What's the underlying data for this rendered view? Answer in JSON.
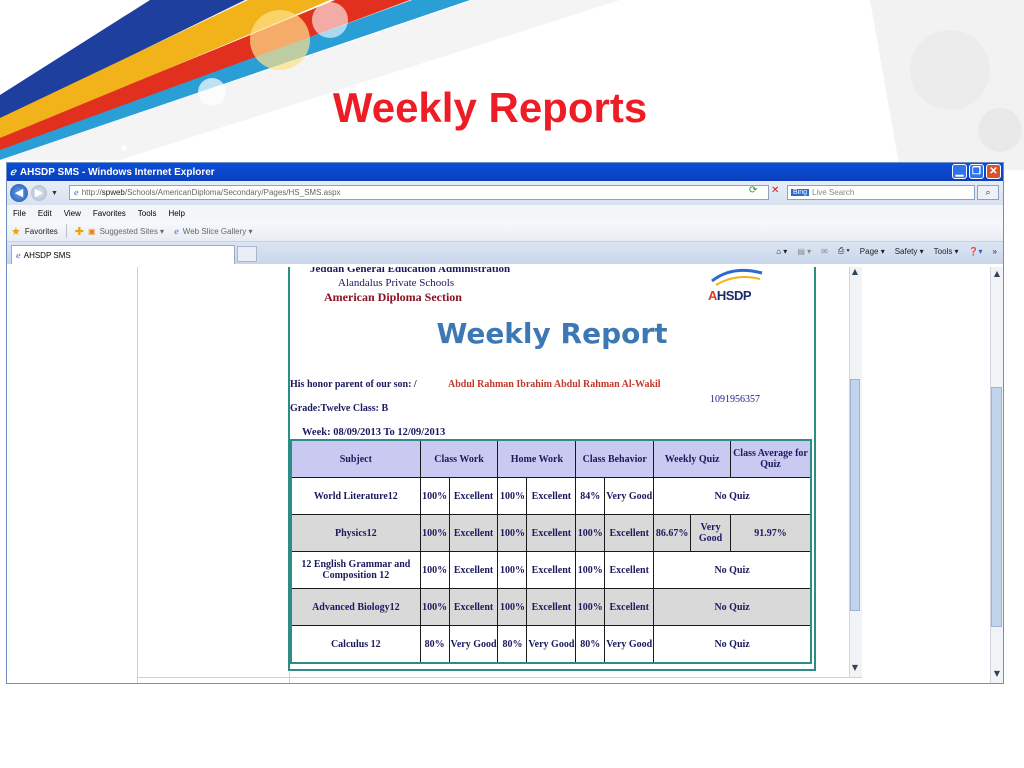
{
  "slide": {
    "title": "Weekly Reports"
  },
  "browser": {
    "window_title": "AHSDP SMS - Windows Internet Explorer",
    "url_prefix": "http://",
    "url_host": "spweb",
    "url_path": "/Schools/AmericanDiploma/Secondary/Pages/HS_SMS.aspx",
    "search_placeholder": "Live Search",
    "search_brand": "Bing",
    "menu": [
      "File",
      "Edit",
      "View",
      "Favorites",
      "Tools",
      "Help"
    ],
    "favorites_label": "Favorites",
    "suggested_sites": "Suggested Sites ▾",
    "web_slice": "Web Slice Gallery ▾",
    "tab_title": "AHSDP SMS",
    "commands": [
      "Page ▾",
      "Safety ▾",
      "Tools ▾"
    ]
  },
  "report": {
    "admin_line": "Jeddah General Education Administration",
    "school": "Alandalus Private Schools",
    "section": "American Diploma Section",
    "logo_text_a": "A",
    "logo_text_b": "HSDP",
    "title": "Weekly Report",
    "parent_label": "His honor parent of our son:     /",
    "student_name": "Abdul Rahman Ibrahim Abdul Rahman Al-Wakil",
    "student_id": "1091956357",
    "grade_line": "Grade:Twelve   Class:   B",
    "week_line": "Week: 08/09/2013 To 12/09/2013",
    "headers": [
      "Subject",
      "Class Work",
      "Home Work",
      "Class Behavior",
      "Weekly Quiz",
      "Class Average for Quiz"
    ],
    "rows": [
      {
        "subject": "World Literature12",
        "cw": "100%",
        "cw_g": "Excellent",
        "hw": "100%",
        "hw_g": "Excellent",
        "cb": "84%",
        "cb_g": "Very Good",
        "quiz": "No Quiz"
      },
      {
        "subject": "Physics12",
        "cw": "100%",
        "cw_g": "Excellent",
        "hw": "100%",
        "hw_g": "Excellent",
        "cb": "100%",
        "cb_g": "Excellent",
        "quiz_pct": "86.67%",
        "quiz_g": "Very Good",
        "avg": "91.97%"
      },
      {
        "subject": "12 English Grammar and Composition 12",
        "cw": "100%",
        "cw_g": "Excellent",
        "hw": "100%",
        "hw_g": "Excellent",
        "cb": "100%",
        "cb_g": "Excellent",
        "quiz": "No Quiz"
      },
      {
        "subject": "Advanced Biology12",
        "cw": "100%",
        "cw_g": "Excellent",
        "hw": "100%",
        "hw_g": "Excellent",
        "cb": "100%",
        "cb_g": "Excellent",
        "quiz": "No Quiz"
      },
      {
        "subject": "Calculus 12",
        "cw": "80%",
        "cw_g": "Very Good",
        "hw": "80%",
        "hw_g": "Very Good",
        "cb": "80%",
        "cb_g": "Very Good",
        "quiz": "No Quiz"
      }
    ]
  },
  "colors": {
    "title_red": "#ee1c24",
    "report_blue": "#3c78b4",
    "header_lilac": "#c9c9f2",
    "teal_border": "#2c8c86"
  }
}
